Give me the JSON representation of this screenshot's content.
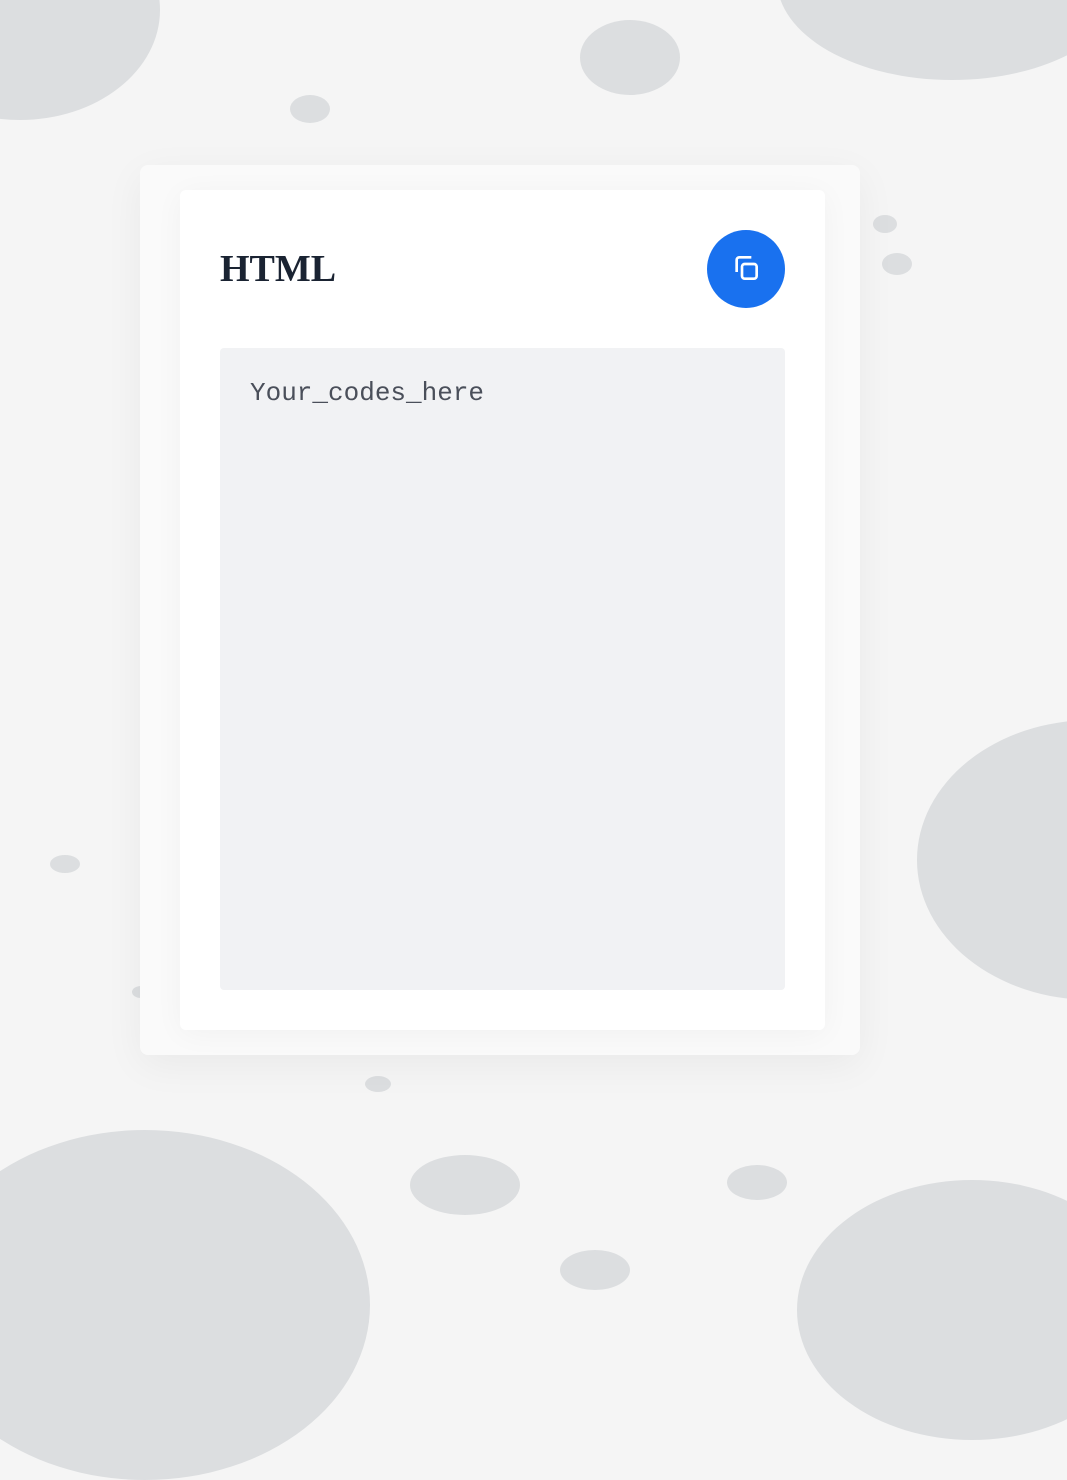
{
  "card": {
    "title": "HTML",
    "code_placeholder": "Your_codes_here"
  },
  "colors": {
    "accent": "#1971ef",
    "background": "#f5f5f5",
    "ellipse": "#dcdee0",
    "card_bg": "#ffffff",
    "code_bg": "#f1f2f4",
    "title_color": "#1a2332",
    "code_color": "#4a4f5a"
  }
}
